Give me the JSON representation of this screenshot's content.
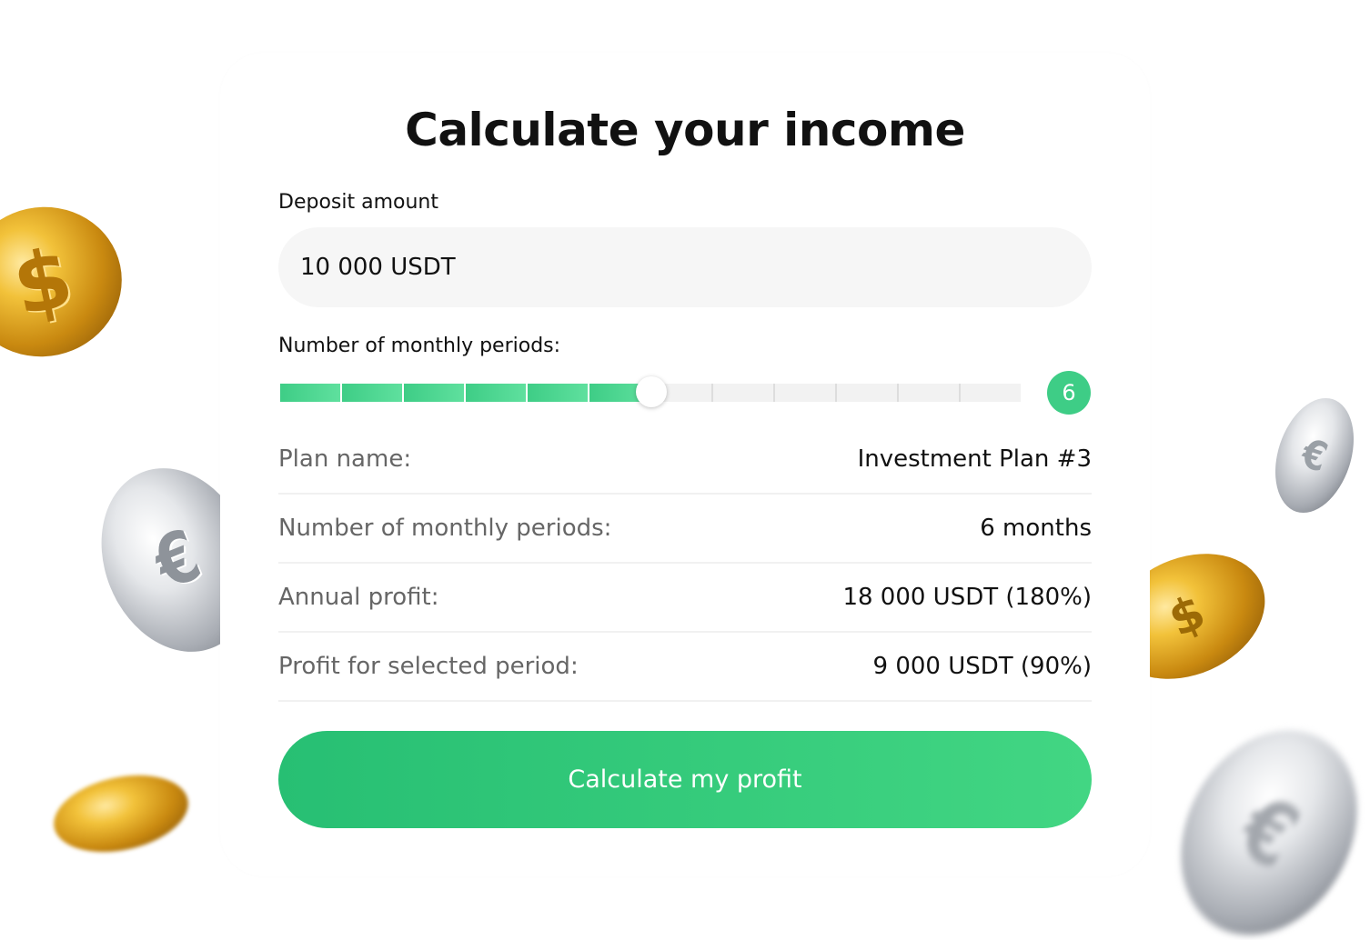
{
  "calculator": {
    "title": "Calculate your income",
    "deposit_label": "Deposit amount",
    "deposit_value": "10 000 USDT",
    "periods_label": "Number of monthly periods:",
    "slider": {
      "min": 1,
      "max": 12,
      "value": 6,
      "display": "6"
    },
    "summary": [
      {
        "label": "Plan name:",
        "value": "Investment Plan #3"
      },
      {
        "label": "Number of monthly periods:",
        "value": "6 months"
      },
      {
        "label": "Annual profit:",
        "value": "18 000 USDT (180%)"
      },
      {
        "label": "Profit for selected period:",
        "value": "9 000 USDT (90%)"
      }
    ],
    "cta_label": "Calculate my profit"
  },
  "colors": {
    "accent_green": "#3ecd86",
    "button_gradient_start": "#27bf73",
    "button_gradient_end": "#42d683",
    "text_dark": "#111111",
    "text_muted": "#666666",
    "input_bg": "#f6f6f6"
  },
  "decorations": {
    "coin_icons": [
      "dollar-coin-icon",
      "euro-coin-icon",
      "gold-coin-icon",
      "silver-coin-icon"
    ],
    "dollar_symbol": "$",
    "euro_symbol": "€"
  }
}
